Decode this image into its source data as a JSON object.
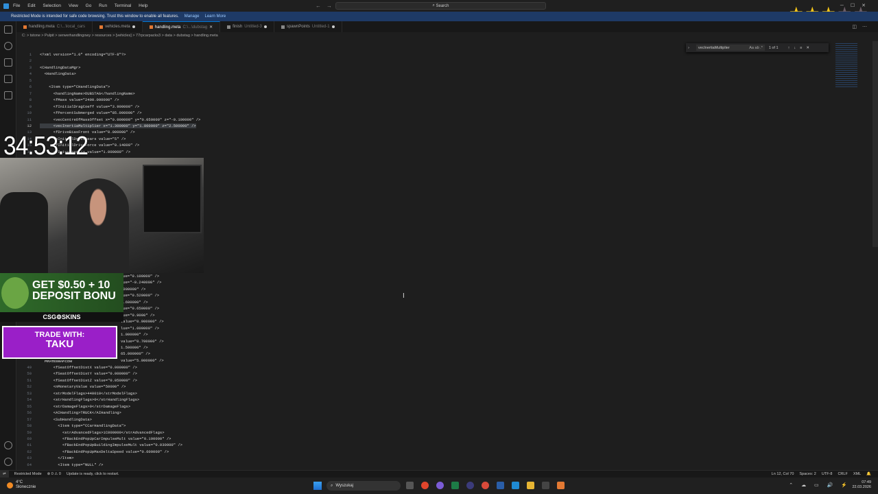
{
  "titlebar": {
    "menu": [
      "File",
      "Edit",
      "Selection",
      "View",
      "Go",
      "Run",
      "Terminal",
      "Help"
    ],
    "search": "Search"
  },
  "banner": {
    "text": "Restricted Mode is intended for safe code browsing. Trust this window to enable all features.",
    "manage": "Manage",
    "learn_more": "Learn More"
  },
  "tabs": [
    {
      "label": "handling.meta",
      "path": "C:\\...\\local_cars",
      "active": false,
      "dirty": false
    },
    {
      "label": "vehicles.meta",
      "path": "",
      "active": false,
      "dirty": true
    },
    {
      "label": "handling.meta",
      "path": "C:\\...\\dubstag",
      "active": true,
      "dirty": false
    },
    {
      "label": "finish",
      "path": "Untitled-3",
      "active": false,
      "dirty": true
    },
    {
      "label": "spawnPoints",
      "path": "Untitled-1",
      "active": false,
      "dirty": true
    }
  ],
  "breadcrumb": "C: > tstone > Pulpit > serwerhandlingowy > resources > [vehicles] > 77rpcarpacks3 > data > dubstag > handling.meta",
  "find": {
    "query": "vecInertiaMultiplier",
    "options": "Aa ab .*",
    "result": "1 of 1"
  },
  "editor_lines": [
    {
      "n": "1",
      "text": "<?xml version=\"1.0\" encoding=\"UTF-8\"?>"
    },
    {
      "n": "2",
      "text": ""
    },
    {
      "n": "3",
      "text": "<CHandlingDataMgr>"
    },
    {
      "n": "4",
      "text": "  <HandlingData>"
    },
    {
      "n": "5",
      "text": ""
    },
    {
      "n": "6",
      "text": "    <Item type=\"CHandlingData\">"
    },
    {
      "n": "7",
      "text": "      <handlingName>DUBSTAG</handlingName>"
    },
    {
      "n": "8",
      "text": "      <fMass value=\"2400.000000\" />"
    },
    {
      "n": "9",
      "text": "      <fInitialDragCoeff value=\"3.900000\" />"
    },
    {
      "n": "10",
      "text": "      <fPercentSubmerged value=\"85.000000\" />"
    },
    {
      "n": "11",
      "text": "      <vecCentreOfMassOffset x=\"0.000000\" y=\"0.050000\" z=\"-0.100000\" />"
    },
    {
      "n": "12",
      "text": "      <vecInertiaMultiplier x=\"1.300000\" y=\"1.800000\" z=\"2.500000\" />"
    },
    {
      "n": "13",
      "text": "      <fDriveBiasFront value=\"0.000000\" />"
    },
    {
      "n": "14",
      "text": "      <nInitialDriveGears value=\"5\" />"
    },
    {
      "n": "15",
      "text": "      <fInitialDriveForce value=\"0.14000\" />"
    },
    {
      "n": "16",
      "text": "      <fDriveInertia value=\"1.000000\" />"
    }
  ],
  "editor_lines_partial": [
    {
      "n": "",
      "text": "lue=\"0.100000\" />"
    },
    {
      "n": "",
      "text": "lue=\"-0.240000\" />"
    },
    {
      "n": "",
      "text": ".000000\" />"
    },
    {
      "n": "",
      "text": "lue=\"0.520000\" />"
    },
    {
      "n": "",
      "text": "0.600000\" />"
    },
    {
      "n": "",
      "text": "lue=\"0.650000\" />"
    },
    {
      "n": "",
      "text": "lue=\"0.9000\" />"
    },
    {
      "n": "",
      "text": "value=\"0.900000\" />"
    },
    {
      "n": "",
      "text": "lue=\"1.000000\" />"
    },
    {
      "n": "",
      "text": "1.000000\" />"
    },
    {
      "n": "",
      "text": "value=\"0.700000\" />"
    },
    {
      "n": "",
      "text": "1.500000\" />"
    },
    {
      "n": "",
      "text": "65.000000\" />"
    },
    {
      "n": "",
      "text": "value=\"5.000000\" />"
    }
  ],
  "editor_lines_bottom": [
    {
      "n": "49",
      "text": "      <fSeatOffsetDistX value=\"0.000000\" />"
    },
    {
      "n": "50",
      "text": "      <fSeatOffsetDistY value=\"0.000000\" />"
    },
    {
      "n": "51",
      "text": "      <fSeatOffsetDistZ value=\"0.050000\" />"
    },
    {
      "n": "52",
      "text": "      <nMonetaryValue value=\"50000\" />"
    },
    {
      "n": "53",
      "text": "      <strModelFlags>440010</strModelFlags>"
    },
    {
      "n": "54",
      "text": "      <strHandlingFlags>0</strHandlingFlags>"
    },
    {
      "n": "55",
      "text": "      <strDamageFlags>0</strDamageFlags>"
    },
    {
      "n": "56",
      "text": "      <AIHandling>TRUCK</AIHandling>"
    },
    {
      "n": "57",
      "text": "      <SubHandlingData>"
    },
    {
      "n": "58",
      "text": "        <Item type=\"CCarHandlingData\">"
    },
    {
      "n": "59",
      "text": "          <strAdvancedFlags>1C000000</strAdvancedFlags>"
    },
    {
      "n": "60",
      "text": "          <fBackEndPopUpCarImpulseMult value=\"0.100000\" />"
    },
    {
      "n": "61",
      "text": "          <fBackEndPopUpBuildingImpulseMult value=\"0.030000\" />"
    },
    {
      "n": "62",
      "text": "          <fBackEndPopUpMaxDeltaSpeed value=\"0.600000\" />"
    },
    {
      "n": "63",
      "text": "        </Item>"
    },
    {
      "n": "64",
      "text": "        <Item type=\"NULL\" />"
    }
  ],
  "overlay": {
    "timer": "34:53:12",
    "promo_line1": "GET $0.50 + 10",
    "promo_line2": "DEPOSIT BONU",
    "skins": "CSG⚙SKINS",
    "trade_a": "TRADE WITH:",
    "trade_b": "TAKU",
    "trade_c": "PIRATESWAP.COM"
  },
  "statusbar": {
    "restricted": "Restricted Mode",
    "problems": "⊗ 0 ⚠ 0",
    "update": "Update is ready, click to restart.",
    "position": "Ln 12, Col 70",
    "spaces": "Spaces: 2",
    "encoding": "UTF-8",
    "eol": "CRLF",
    "language": "XML"
  },
  "taskbar": {
    "temp": "4°C",
    "weather": "Słonecznie",
    "search": "Wyszukaj",
    "time": "07:49",
    "date": "22.03.2026"
  },
  "colors": {
    "accent": "#0078d4",
    "banner": "#1e3a66",
    "trade": "#9a1fc8"
  }
}
